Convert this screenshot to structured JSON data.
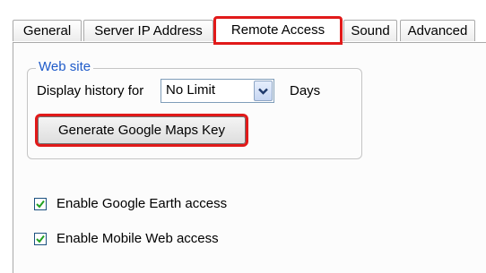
{
  "tabs": [
    {
      "label": "General",
      "active": false
    },
    {
      "label": "Server IP Address",
      "active": false
    },
    {
      "label": "Remote Access",
      "active": true
    },
    {
      "label": "Sound",
      "active": false
    },
    {
      "label": "Advanced",
      "active": false
    }
  ],
  "group": {
    "legend": "Web site",
    "history_label": "Display history for",
    "history_value": "No Limit",
    "days_label": "Days",
    "generate_button": "Generate Google Maps Key"
  },
  "options": [
    {
      "label": "Enable Google Earth access",
      "checked": true
    },
    {
      "label": "Enable Mobile Web access",
      "checked": true
    }
  ],
  "colors": {
    "highlight": "#e11a1a",
    "legend": "#1f5bc9",
    "check": "#21a121"
  }
}
